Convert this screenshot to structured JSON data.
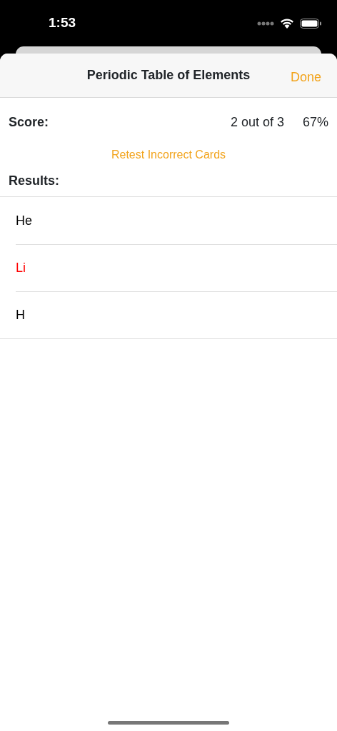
{
  "status_bar": {
    "time": "1:53"
  },
  "sheet": {
    "title": "Periodic Table of Elements",
    "done_button": "Done"
  },
  "score": {
    "label": "Score:",
    "count": "2 out of 3",
    "percent": "67%"
  },
  "retest_button": "Retest Incorrect Cards",
  "results": {
    "label": "Results:",
    "rows": [
      {
        "symbol": "He",
        "correct": true
      },
      {
        "symbol": "Li",
        "correct": false
      },
      {
        "symbol": "H",
        "correct": true
      }
    ]
  }
}
